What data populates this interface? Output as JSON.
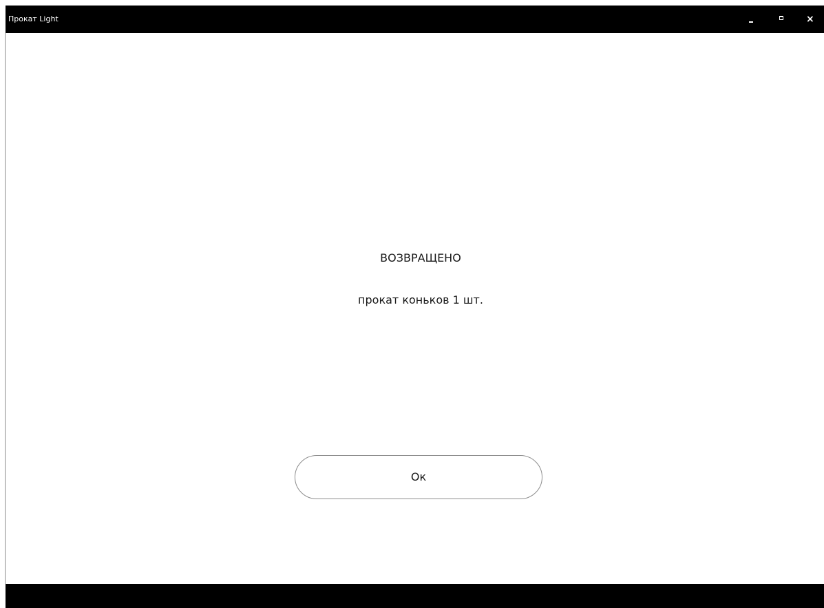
{
  "window": {
    "title": "Прокат Light",
    "controls": {
      "minimize_icon": "minimize-icon",
      "maximize_icon": "maximize-icon",
      "close_icon": "close-icon",
      "close_glyph": "×"
    }
  },
  "main": {
    "status": "ВОЗВРАЩЕНО",
    "detail": "прокат коньков  1 шт.",
    "ok_label": "Ок"
  },
  "colors": {
    "titlebar": "#000000",
    "background": "#ffffff",
    "text": "#1a1a1a",
    "button_border": "#8c8c8c"
  }
}
